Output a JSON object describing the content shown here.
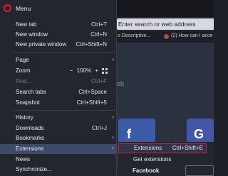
{
  "menu": {
    "title": "Menu",
    "items": [
      {
        "label": "New tab",
        "shortcut": "Ctrl+T"
      },
      {
        "label": "New window",
        "shortcut": "Ctrl+N"
      },
      {
        "label": "New private window",
        "shortcut": "Ctrl+Shift+N"
      },
      {
        "label": "Page",
        "shortcut": ""
      },
      {
        "label": "Zoom",
        "shortcut": ""
      },
      {
        "label": "Find...",
        "shortcut": "Ctrl+F"
      },
      {
        "label": "Search tabs",
        "shortcut": "Ctrl+Space"
      },
      {
        "label": "Snapshot",
        "shortcut": "Ctrl+Shift+5"
      },
      {
        "label": "History",
        "shortcut": ""
      },
      {
        "label": "Downloads",
        "shortcut": "Ctrl+J"
      },
      {
        "label": "Bookmarks",
        "shortcut": ""
      },
      {
        "label": "Extensions",
        "shortcut": ""
      },
      {
        "label": "News",
        "shortcut": ""
      },
      {
        "label": "Synchronize...",
        "shortcut": ""
      }
    ],
    "zoom": {
      "minus": "−",
      "value": "100%",
      "plus": "+"
    },
    "arrow": "›"
  },
  "submenu": {
    "items": [
      {
        "label": "Extensions",
        "shortcut": "Ctrl+Shift+E"
      },
      {
        "label": "Get extensions",
        "shortcut": ""
      }
    ]
  },
  "browser": {
    "address_placeholder": "Enter search or web address",
    "bookmarks": [
      {
        "label": "o Descriptive..."
      },
      {
        "label": "(2) How can I acce"
      }
    ],
    "search_ghost": "eb",
    "speed_dial": [
      {
        "label": "Facebook",
        "glyph": "f"
      },
      {
        "label": "",
        "glyph": "G"
      }
    ]
  },
  "colors": {
    "menu_bg": "#23262e",
    "highlight": "#3b4a66",
    "selected_border": "#d4202a",
    "opera_red": "#e6192b"
  },
  "icons": {
    "logo": "opera-logo-icon",
    "submenu": "chevron-right-icon",
    "fullscreen": "fullscreen-icon"
  }
}
